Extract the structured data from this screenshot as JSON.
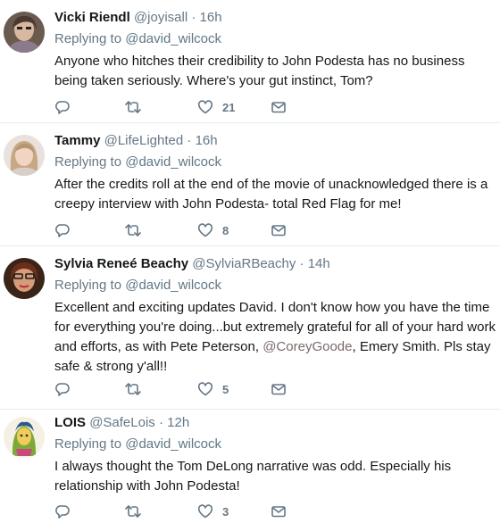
{
  "tweets": [
    {
      "name": "Vicki Riendl",
      "handle": "@joyisall",
      "time": "16h",
      "reply_prefix": "Replying to",
      "reply_to": "@david_wilcock",
      "text": "Anyone who hitches their credibility to John Podesta has no business being taken seriously.  Where's your gut instinct, Tom?",
      "likes": "21"
    },
    {
      "name": "Tammy",
      "handle": "@LifeLighted",
      "time": "16h",
      "reply_prefix": "Replying to",
      "reply_to": "@david_wilcock",
      "text": "After the credits roll at the end of the movie of unacknowledged there is a creepy interview with John Podesta- total Red Flag for me!",
      "likes": "8"
    },
    {
      "name": "Sylvia Reneé Beachy",
      "handle": "@SylviaRBeachy",
      "time": "14h",
      "reply_prefix": "Replying to",
      "reply_to": "@david_wilcock",
      "text_before": "Excellent and exciting updates David. I don't know how you have the time for everything you're doing...but extremely grateful for all of your hard work and efforts, as with Pete Peterson, ",
      "mention": "@CoreyGoode",
      "text_after": ", Emery Smith. Pls stay safe & strong y'all!!",
      "likes": "5"
    },
    {
      "name": "LOIS",
      "handle": "@SafeLois",
      "time": "12h",
      "reply_prefix": "Replying to",
      "reply_to": "@david_wilcock",
      "text": "I always thought the Tom DeLong narrative was odd. Especially his relationship with John Podesta!",
      "likes": "3"
    }
  ],
  "separator": "·",
  "icons": {
    "reply": "reply-icon",
    "retweet": "retweet-icon",
    "like": "heart-icon",
    "dm": "envelope-icon"
  },
  "colors": {
    "name": "#14171a",
    "meta": "#657786",
    "mention": "#7d6a6a",
    "divider": "#e6ecf0"
  }
}
